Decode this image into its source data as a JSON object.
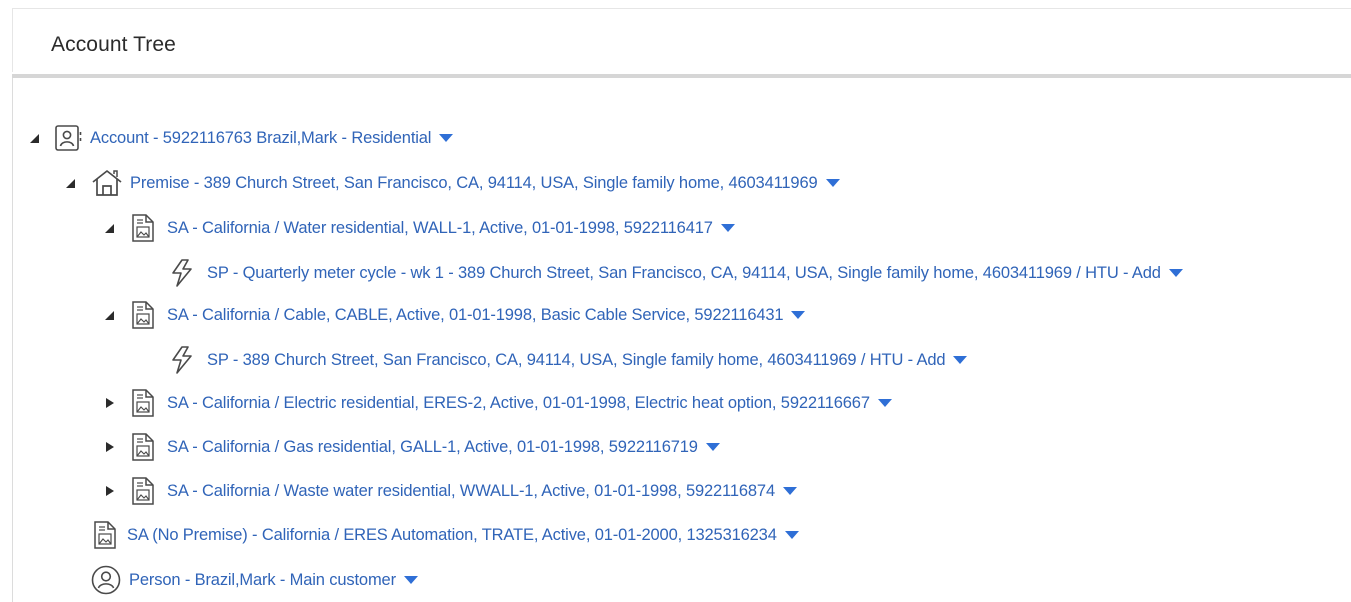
{
  "panel": {
    "title": "Account Tree"
  },
  "colors": {
    "link": "#3064b8",
    "toggle": "#2b2b2b",
    "icon_stroke": "#4a4a4a",
    "menu_caret": "#2f6fd6"
  },
  "tree": {
    "account": {
      "label": "Account - 5922116763 Brazil,Mark - Residential",
      "icon": "account-card-icon",
      "state": "expanded"
    },
    "premise": {
      "label": "Premise - 389 Church Street, San Francisco, CA, 94114, USA, Single family home, 4603411969",
      "icon": "house-icon",
      "state": "expanded"
    },
    "sa_water": {
      "label": "SA - California / Water residential, WALL-1, Active, 01-01-1998, 5922116417",
      "icon": "document-icon",
      "state": "expanded"
    },
    "sp_water": {
      "label": "SP - Quarterly meter cycle - wk 1 - 389 Church Street, San Francisco, CA, 94114, USA, Single family home, 4603411969 / HTU - Add",
      "icon": "lightning-icon"
    },
    "sa_cable": {
      "label": "SA - California / Cable, CABLE, Active, 01-01-1998, Basic Cable Service, 5922116431",
      "icon": "document-icon",
      "state": "expanded"
    },
    "sp_cable": {
      "label": "SP - 389 Church Street, San Francisco, CA, 94114, USA, Single family home, 4603411969 / HTU - Add",
      "icon": "lightning-icon"
    },
    "sa_electric": {
      "label": "SA - California / Electric residential, ERES-2, Active, 01-01-1998, Electric heat option, 5922116667",
      "icon": "document-icon",
      "state": "collapsed"
    },
    "sa_gas": {
      "label": "SA - California / Gas residential, GALL-1, Active, 01-01-1998, 5922116719",
      "icon": "document-icon",
      "state": "collapsed"
    },
    "sa_waste": {
      "label": "SA - California / Waste water residential, WWALL-1, Active, 01-01-1998, 5922116874",
      "icon": "document-icon",
      "state": "collapsed"
    },
    "sa_no_premise": {
      "label": "SA (No Premise) - California / ERES Automation, TRATE, Active, 01-01-2000, 1325316234",
      "icon": "document-icon"
    },
    "person": {
      "label": "Person - Brazil,Mark - Main customer",
      "icon": "person-circle-icon"
    }
  }
}
